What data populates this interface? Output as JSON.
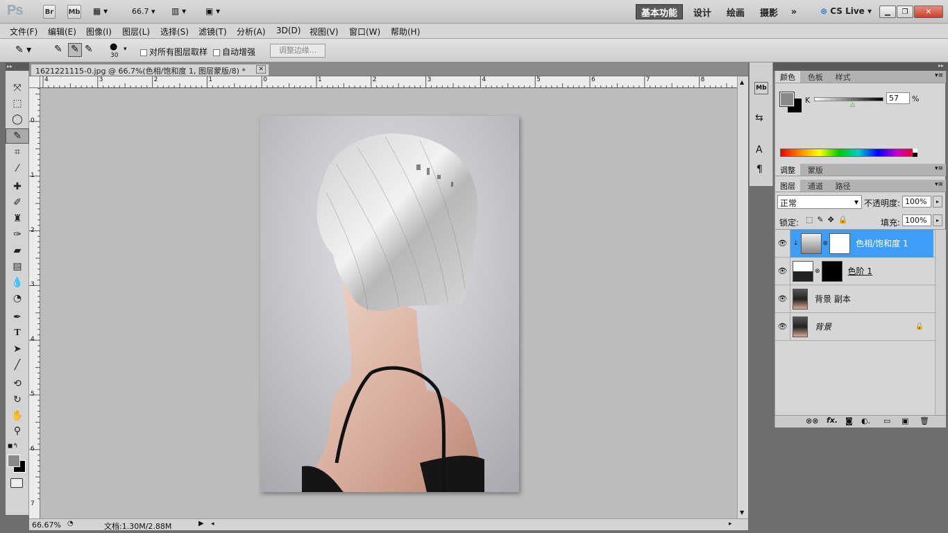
{
  "appbar": {
    "logo": "Ps",
    "br": "Br",
    "mb": "Mb",
    "zoom": "66.7",
    "workspaces": [
      "基本功能",
      "设计",
      "绘画",
      "摄影"
    ],
    "more": "»",
    "cslive": "CS Live"
  },
  "menu": [
    "文件(F)",
    "编辑(E)",
    "图像(I)",
    "图层(L)",
    "选择(S)",
    "滤镜(T)",
    "分析(A)",
    "3D(D)",
    "视图(V)",
    "窗口(W)",
    "帮助(H)"
  ],
  "options": {
    "brush_size": "30",
    "sample_all": "对所有图层取样",
    "auto_enhance": "自动增强",
    "refine_edge": "调整边缘..."
  },
  "document": {
    "tab_title": "1621221115-0.jpg @ 66.7%(色相/饱和度 1, 图层蒙版/8) *",
    "ruler_top": [
      "4",
      "3",
      "2",
      "1",
      "0",
      "1",
      "2",
      "3",
      "4",
      "5",
      "6",
      "7",
      "8"
    ],
    "ruler_left": [
      "0",
      "1",
      "2",
      "3",
      "4",
      "5",
      "6",
      "7"
    ]
  },
  "status": {
    "zoom": "66.67%",
    "doc": "文档:1.30M/2.88M"
  },
  "color_panel": {
    "tabs": [
      "颜色",
      "色板",
      "样式"
    ],
    "channel": "K",
    "value": "57",
    "unit": "%"
  },
  "adjust_panel": {
    "tabs": [
      "调整",
      "蒙版"
    ]
  },
  "layers_panel": {
    "tabs": [
      "图层",
      "通道",
      "路径"
    ],
    "blend": "正常",
    "opacity_label": "不透明度:",
    "opacity": "100%",
    "lock_label": "锁定:",
    "fill_label": "填充:",
    "fill": "100%",
    "layers": [
      {
        "name": "色相/饱和度 1",
        "selected": true
      },
      {
        "name": "色阶 1",
        "selected": false
      },
      {
        "name": "背景 副本",
        "selected": false
      },
      {
        "name": "背景",
        "selected": false
      }
    ]
  },
  "colors": {
    "accent": "#3a8ff5",
    "selected_layer": "#3d9df7"
  }
}
